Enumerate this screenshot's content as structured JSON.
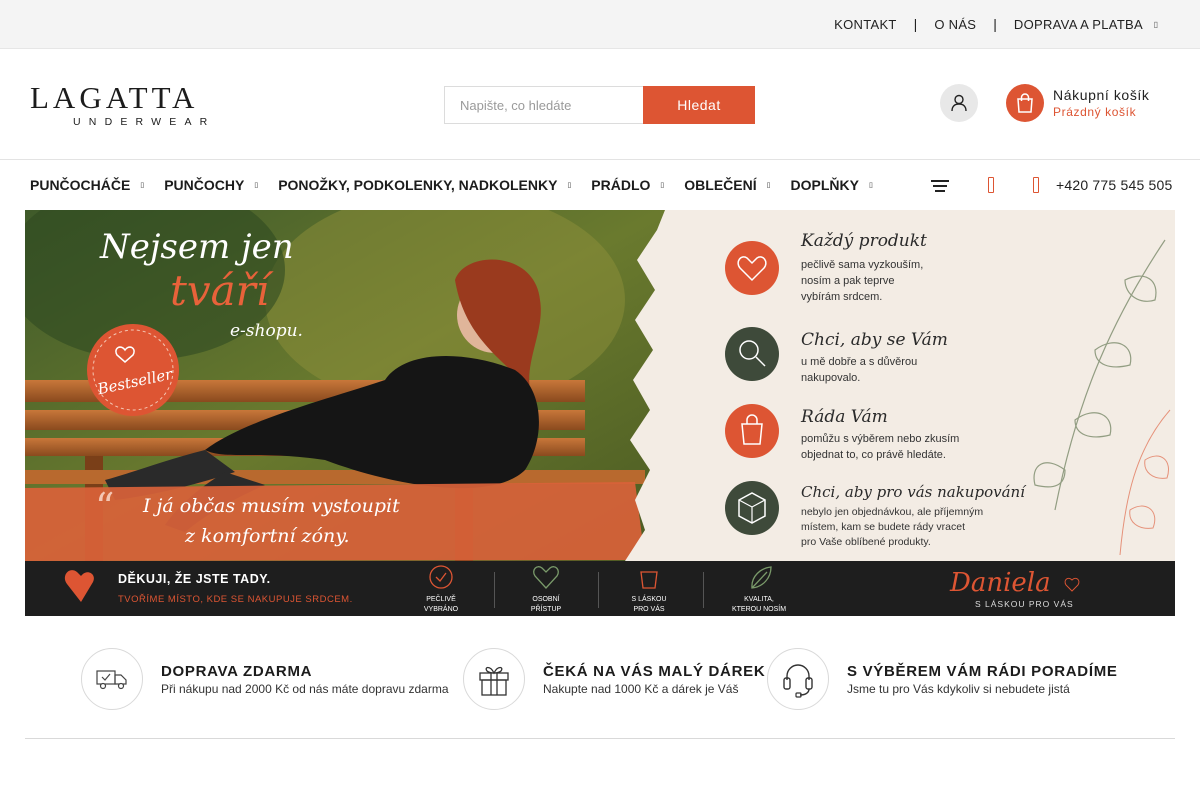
{
  "topbar": {
    "links": [
      "KONTAKT",
      "O NÁS",
      "DOPRAVA A PLATBA"
    ],
    "separator": "|",
    "more": "▯"
  },
  "header": {
    "logo_main": "LAGATTA",
    "logo_sub": "UNDERWEAR",
    "search_placeholder": "Napište, co hledáte",
    "search_button": "Hledat",
    "cart_title": "Nákupní košík",
    "cart_status": "Prázdný košík"
  },
  "nav": {
    "items": [
      "PUNČOCHÁČE",
      "PUNČOCHY",
      "PONOŽKY, PODKOLENKY, NADKOLENKY",
      "PRÁDLO",
      "OBLEČENÍ",
      "DOPLŇKY"
    ],
    "arrow": "▯",
    "phone": "+420 775 545 505"
  },
  "banner": {
    "headline_1": "Nejsem jen",
    "headline_2": "tváří",
    "headline_3": "e-shopu.",
    "badge": "Bestseller",
    "quote_1": "I já občas musím vystoupit",
    "quote_2": "z komfortní zóny.",
    "points": [
      {
        "title": "Každý produkt",
        "lines": [
          "pečlivě sama vyzkouším,",
          "nosím a pak teprve",
          "vybírám srdcem."
        ]
      },
      {
        "title": "Chci, aby se Vám",
        "lines": [
          "u mě dobře a s důvěrou",
          "nakupovalo."
        ]
      },
      {
        "title": "Ráda Vám",
        "lines": [
          "pomůžu s výběrem nebo zkusím",
          "objednat to, co právě hledáte."
        ]
      },
      {
        "title": "Chci, aby pro vás nakupování",
        "lines": [
          "nebylo jen objednávkou, ale příjemným",
          "místem, kam se budete rády vracet",
          "pro Vaše oblíbené produkty."
        ]
      }
    ],
    "footer_title": "DĚKUJI, ŽE JSTE TADY.",
    "footer_sub": "TVOŘÍME MÍSTO, KDE SE NAKUPUJE SRDCEM.",
    "footer_icons": [
      [
        "PEČLIVĚ",
        "VYBRÁNO"
      ],
      [
        "OSOBNÍ",
        "PŘÍSTUP"
      ],
      [
        "S LÁSKOU",
        "PRO VÁS"
      ],
      [
        "KVALITA,",
        "KTEROU NOSÍM"
      ]
    ],
    "signature": "Daniela",
    "signature_sub": "S LÁSKOU PRO VÁS"
  },
  "benefits": [
    {
      "title": "DOPRAVA ZDARMA",
      "desc": "Při nákupu nad 2000 Kč od nás máte dopravu zdarma",
      "icon": "truck-icon"
    },
    {
      "title": "ČEKÁ NA VÁS MALÝ DÁREK",
      "desc": "Nakupte nad 1000 Kč a dárek je Váš",
      "icon": "gift-icon"
    },
    {
      "title": "S VÝBĚREM VÁM RÁDI PORADÍME",
      "desc": "Jsme tu pro Vás kdykoliv si nebudete jistá",
      "icon": "headset-icon"
    }
  ],
  "colors": {
    "accent": "#dd5533",
    "topbar_bg": "#f4f4f4",
    "banner_footer": "#1e1e1e"
  }
}
